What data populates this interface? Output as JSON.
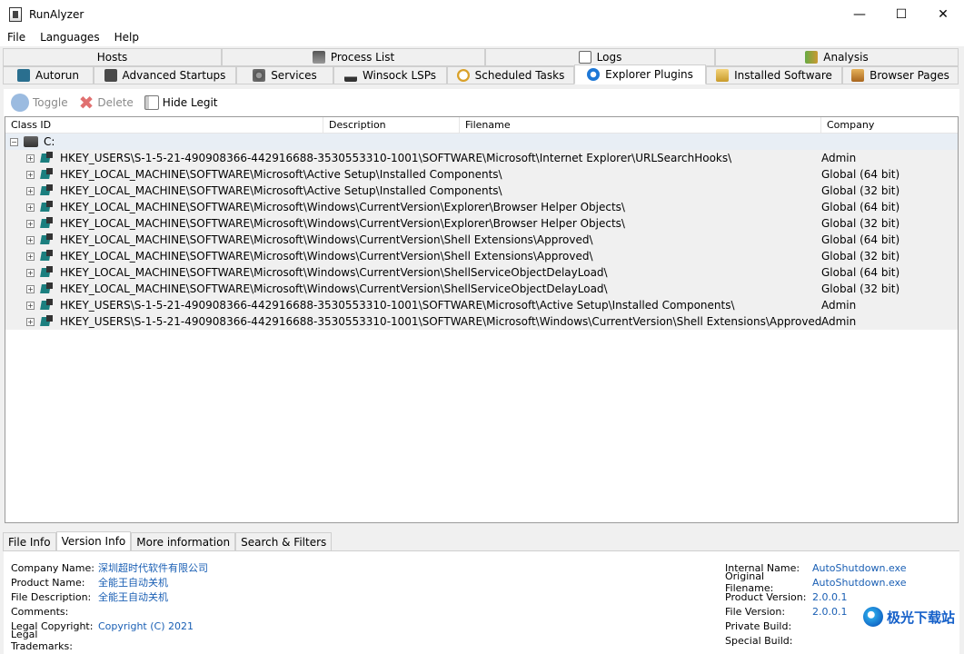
{
  "window": {
    "title": "RunAlyzer",
    "minimize": "—",
    "maximize": "☐",
    "close": "✕"
  },
  "menu": [
    "File",
    "Languages",
    "Help"
  ],
  "tabs_row1": [
    {
      "label": "Hosts",
      "icon": "none"
    },
    {
      "label": "Process List",
      "icon": "process-icon"
    },
    {
      "label": "Logs",
      "icon": "logs-icon"
    },
    {
      "label": "Analysis",
      "icon": "analysis-icon"
    }
  ],
  "tabs_row2": [
    {
      "label": "Autorun",
      "icon": "autorun-icon"
    },
    {
      "label": "Advanced Startups",
      "icon": "startup-icon"
    },
    {
      "label": "Services",
      "icon": "services-icon"
    },
    {
      "label": "Winsock LSPs",
      "icon": "network-icon"
    },
    {
      "label": "Scheduled Tasks",
      "icon": "clock-icon"
    },
    {
      "label": "Explorer Plugins",
      "icon": "ie-icon",
      "active": true
    },
    {
      "label": "Installed Software",
      "icon": "software-icon"
    },
    {
      "label": "Browser Pages",
      "icon": "home-icon"
    }
  ],
  "toolbar": {
    "toggle": "Toggle",
    "delete": "Delete",
    "hide_legit": "Hide Legit"
  },
  "columns": [
    "Class ID",
    "Description",
    "Filename",
    "Company"
  ],
  "root": {
    "label": "C:"
  },
  "rows": [
    {
      "key": "HKEY_USERS\\S-1-5-21-490908366-442916688-3530553310-1001\\SOFTWARE\\Microsoft\\Internet Explorer\\URLSearchHooks\\",
      "company": "Admin"
    },
    {
      "key": "HKEY_LOCAL_MACHINE\\SOFTWARE\\Microsoft\\Active Setup\\Installed Components\\",
      "company": "Global (64 bit)"
    },
    {
      "key": "HKEY_LOCAL_MACHINE\\SOFTWARE\\Microsoft\\Active Setup\\Installed Components\\",
      "company": "Global (32 bit)"
    },
    {
      "key": "HKEY_LOCAL_MACHINE\\SOFTWARE\\Microsoft\\Windows\\CurrentVersion\\Explorer\\Browser Helper Objects\\",
      "company": "Global (64 bit)"
    },
    {
      "key": "HKEY_LOCAL_MACHINE\\SOFTWARE\\Microsoft\\Windows\\CurrentVersion\\Explorer\\Browser Helper Objects\\",
      "company": "Global (32 bit)"
    },
    {
      "key": "HKEY_LOCAL_MACHINE\\SOFTWARE\\Microsoft\\Windows\\CurrentVersion\\Shell Extensions\\Approved\\",
      "company": "Global (64 bit)"
    },
    {
      "key": "HKEY_LOCAL_MACHINE\\SOFTWARE\\Microsoft\\Windows\\CurrentVersion\\Shell Extensions\\Approved\\",
      "company": "Global (32 bit)"
    },
    {
      "key": "HKEY_LOCAL_MACHINE\\SOFTWARE\\Microsoft\\Windows\\CurrentVersion\\ShellServiceObjectDelayLoad\\",
      "company": "Global (64 bit)"
    },
    {
      "key": "HKEY_LOCAL_MACHINE\\SOFTWARE\\Microsoft\\Windows\\CurrentVersion\\ShellServiceObjectDelayLoad\\",
      "company": "Global (32 bit)"
    },
    {
      "key": "HKEY_USERS\\S-1-5-21-490908366-442916688-3530553310-1001\\SOFTWARE\\Microsoft\\Active Setup\\Installed Components\\",
      "company": "Admin"
    },
    {
      "key": "HKEY_USERS\\S-1-5-21-490908366-442916688-3530553310-1001\\SOFTWARE\\Microsoft\\Windows\\CurrentVersion\\Shell Extensions\\Approved\\",
      "company": "Admin"
    }
  ],
  "bottom_tabs": [
    {
      "label": "File Info"
    },
    {
      "label": "Version Info",
      "active": true
    },
    {
      "label": "More information"
    },
    {
      "label": "Search & Filters"
    }
  ],
  "info_left": [
    {
      "label": "Company Name:",
      "value": "深圳超时代软件有限公司"
    },
    {
      "label": "Product Name:",
      "value": "全能王自动关机"
    },
    {
      "label": "File Description:",
      "value": "全能王自动关机"
    },
    {
      "label": "Comments:",
      "value": ""
    },
    {
      "label": "Legal Copyright:",
      "value": "Copyright (C) 2021"
    },
    {
      "label": "Legal Trademarks:",
      "value": ""
    }
  ],
  "info_right": [
    {
      "label": "Internal Name:",
      "value": "AutoShutdown.exe"
    },
    {
      "label": "Original Filename:",
      "value": "AutoShutdown.exe"
    },
    {
      "label": "Product Version:",
      "value": "2.0.0.1"
    },
    {
      "label": "File Version:",
      "value": "2.0.0.1"
    },
    {
      "label": "Private Build:",
      "value": ""
    },
    {
      "label": "Special Build:",
      "value": ""
    }
  ],
  "watermark": "极光下载站",
  "colors": {
    "link": "#1a5fb4",
    "row_bg": "#f0f0f0",
    "root_bg": "#e8eef5"
  }
}
